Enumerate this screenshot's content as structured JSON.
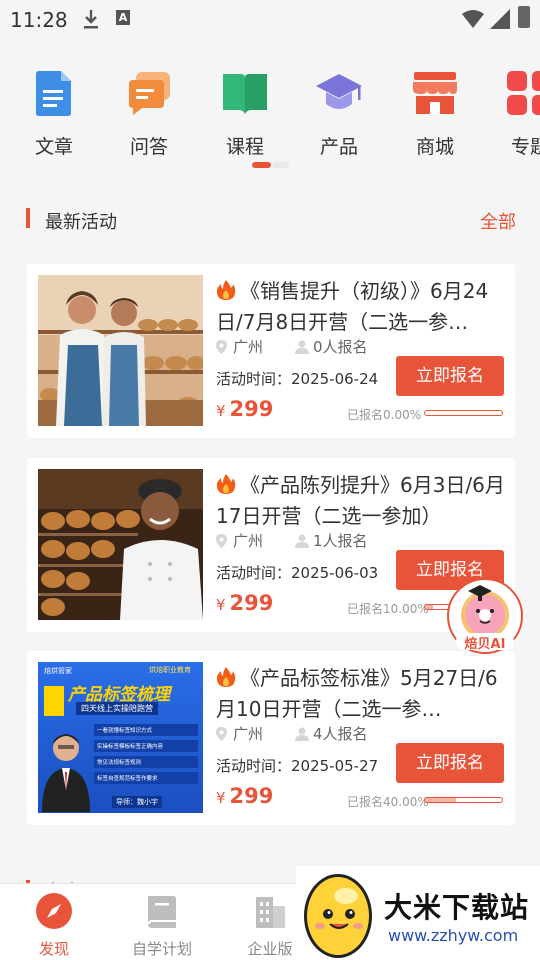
{
  "status_bar": {
    "time": "11:28"
  },
  "categories": [
    {
      "label": "文章",
      "icon": "article-icon",
      "color": "#3d8fe6"
    },
    {
      "label": "问答",
      "icon": "qa-icon",
      "color": "#f28b3c"
    },
    {
      "label": "课程",
      "icon": "course-book-icon",
      "color": "#33b779"
    },
    {
      "label": "产品",
      "icon": "graduation-cap-icon",
      "color": "#7b74d9"
    },
    {
      "label": "商城",
      "icon": "shop-icon",
      "color": "#e8543a"
    },
    {
      "label": "专题",
      "icon": "topic-grid-icon",
      "color": "#f04a4a"
    }
  ],
  "activity_section": {
    "title": "最新活动",
    "more": "全部"
  },
  "activities": [
    {
      "title": "《销售提升（初级）》6月24日/7月8日开营（二选一参…",
      "city": "广州",
      "signups": "0人报名",
      "time_label": "活动时间：2025-06-24",
      "currency": "¥",
      "price": "299",
      "button": "立即报名",
      "progress_text": "已报名0.00%",
      "progress": 0.0
    },
    {
      "title": "《产品陈列提升》6月3日/6月17日开营（二选一参加）",
      "city": "广州",
      "signups": "1人报名",
      "time_label": "活动时间：2025-06-03",
      "currency": "¥",
      "price": "299",
      "button": "立即报名",
      "progress_text": "已报名10.00%",
      "progress": 0.1
    },
    {
      "title": "《产品标签标准》5月27日/6月10日开营（二选一参…",
      "city": "广州",
      "signups": "4人报名",
      "time_label": "活动时间：2025-05-27",
      "currency": "¥",
      "price": "299",
      "button": "立即报名",
      "progress_text": "已报名40.00%",
      "progress": 0.4,
      "poster": {
        "brand": "焙烘管家",
        "tag": "烘焙职业教育",
        "headline": "产品标签梳理",
        "sub": "四天线上实操陪跑营",
        "points": [
          "一看就懂标签知识方式",
          "实操标签模板标签正确内容",
          "常见法规标签规则",
          "标签自查规范标签作要求"
        ],
        "speaker": "导师：魏小宇"
      }
    }
  ],
  "second_section": {
    "title": "名声"
  },
  "bottom_nav": [
    {
      "label": "发现",
      "icon": "compass-icon",
      "active": true
    },
    {
      "label": "自学计划",
      "icon": "book-icon",
      "active": false
    },
    {
      "label": "企业版",
      "icon": "building-icon",
      "active": false
    }
  ],
  "assistant": {
    "label": "焙贝AI"
  },
  "watermark": {
    "text": "大米下载站",
    "url": "www.zzhyw.com"
  },
  "colors": {
    "accent": "#e8543a"
  }
}
